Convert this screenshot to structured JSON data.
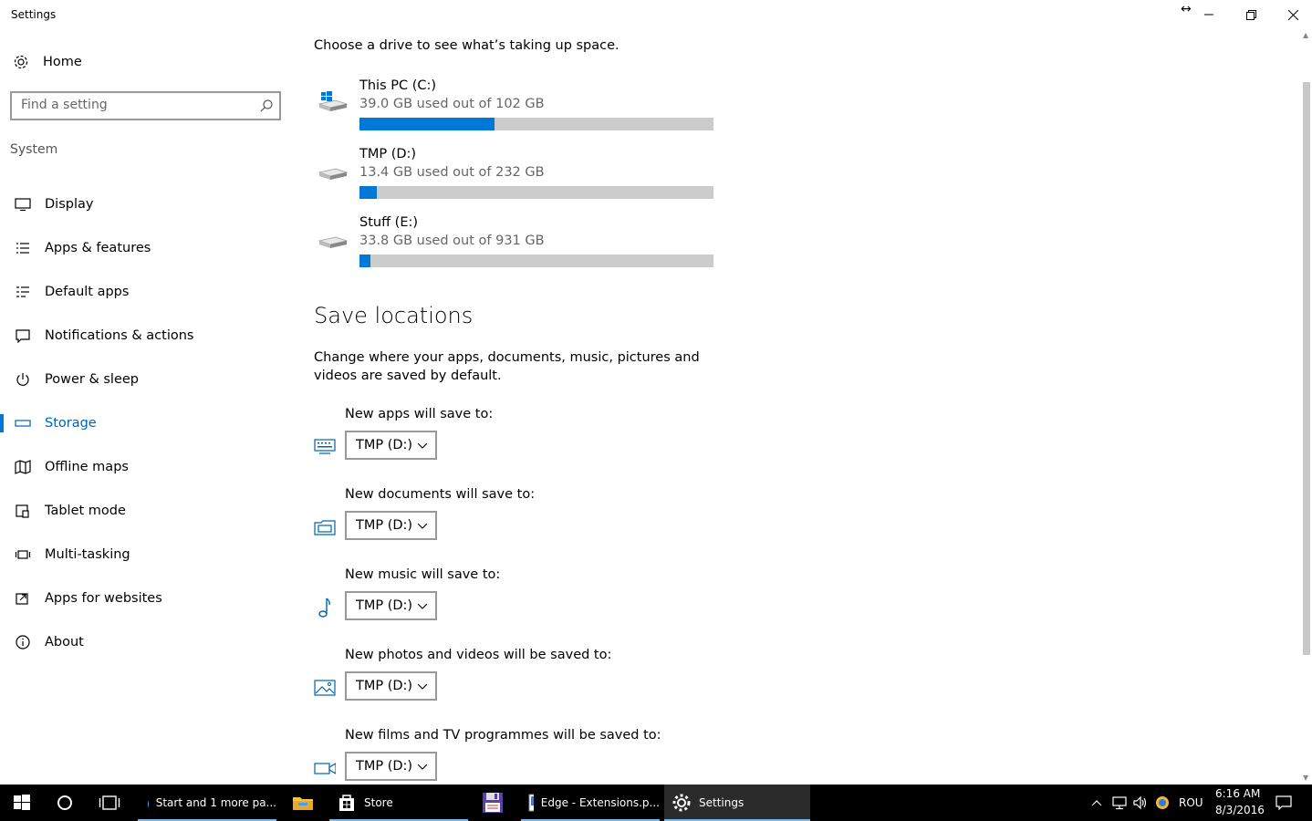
{
  "window": {
    "title": "Settings",
    "minimize_label": "—",
    "maximize_label": "❐",
    "close_label": "✕",
    "resize_label": "↔"
  },
  "sidebar": {
    "home_label": "Home",
    "search_placeholder": "Find a setting",
    "section_label": "System",
    "items": [
      {
        "label": "Display",
        "icon": "display-icon"
      },
      {
        "label": "Apps & features",
        "icon": "list-icon"
      },
      {
        "label": "Default apps",
        "icon": "default-apps-icon"
      },
      {
        "label": "Notifications & actions",
        "icon": "notification-icon"
      },
      {
        "label": "Power & sleep",
        "icon": "power-icon"
      },
      {
        "label": "Storage",
        "icon": "storage-icon",
        "active": true
      },
      {
        "label": "Offline maps",
        "icon": "map-icon"
      },
      {
        "label": "Tablet mode",
        "icon": "tablet-icon"
      },
      {
        "label": "Multi-tasking",
        "icon": "multitasking-icon"
      },
      {
        "label": "Apps for websites",
        "icon": "apps-for-websites-icon"
      },
      {
        "label": "About",
        "icon": "info-icon"
      }
    ]
  },
  "main": {
    "intro": "Choose a drive to see what’s taking up space.",
    "drives": [
      {
        "name": "This PC (C:)",
        "usage": "39.0 GB used out of 102 GB",
        "used_fraction": 0.382
      },
      {
        "name": "TMP (D:)",
        "usage": "13.4 GB used out of 232 GB",
        "used_fraction": 0.048
      },
      {
        "name": "Stuff (E:)",
        "usage": "33.8 GB used out of 931 GB",
        "used_fraction": 0.032
      }
    ],
    "save_heading": "Save locations",
    "save_description": "Change where your apps, documents, music, pictures and videos are saved by default.",
    "locations": [
      {
        "label": "New apps will save to:",
        "value": "TMP (D:)",
        "icon": "monitor-keyboard-icon"
      },
      {
        "label": "New documents will save to:",
        "value": "TMP (D:)",
        "icon": "documents-icon"
      },
      {
        "label": "New music will save to:",
        "value": "TMP (D:)",
        "icon": "music-note-icon"
      },
      {
        "label": "New photos and videos will be saved to:",
        "value": "TMP (D:)",
        "icon": "photo-icon"
      },
      {
        "label": "New films and TV programmes will be saved to:",
        "value": "TMP (D:)",
        "icon": "video-camera-icon"
      }
    ]
  },
  "taskbar": {
    "apps": [
      {
        "label": "Start and 1 more pa...",
        "icon": "edge-icon"
      },
      {
        "label": "",
        "icon": "file-explorer-icon"
      },
      {
        "label": "Store",
        "icon": "store-icon"
      },
      {
        "label": "",
        "icon": "floppy-icon"
      },
      {
        "label": "Edge - Extensions.p...",
        "icon": "image-editor-icon"
      },
      {
        "label": "Settings",
        "icon": "settings-gear-icon"
      }
    ],
    "language": "ROU",
    "time": "6:16 AM",
    "date": "8/3/2016"
  },
  "colors": {
    "accent": "#0078d7",
    "accent_text": "#0063b1",
    "bar_track": "#cccccc",
    "taskbar": "#000000"
  }
}
